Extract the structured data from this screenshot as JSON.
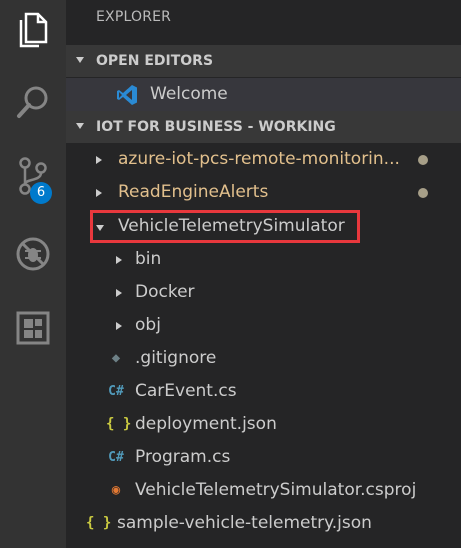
{
  "activity_bar": {
    "items": [
      {
        "icon": "files-icon"
      },
      {
        "icon": "search-icon"
      },
      {
        "icon": "source-control-icon",
        "badge": "6"
      },
      {
        "icon": "debug-icon"
      },
      {
        "icon": "extensions-icon"
      }
    ]
  },
  "sidebar": {
    "title": "EXPLORER",
    "open_editors": {
      "header": "OPEN EDITORS",
      "items": [
        {
          "label": "Welcome",
          "icon": "vscode-logo-icon"
        }
      ]
    },
    "workspace": {
      "header": "IOT FOR BUSINESS - WORKING",
      "items": [
        {
          "label": "azure-iot-pcs-remote-monitorin...",
          "type": "folder",
          "modified": true
        },
        {
          "label": "ReadEngineAlerts",
          "type": "folder",
          "modified": true
        },
        {
          "label": "VehicleTelemetrySimulator",
          "type": "folder",
          "expanded": true,
          "highlighted": true
        },
        {
          "label": "bin",
          "type": "folder"
        },
        {
          "label": "Docker",
          "type": "folder"
        },
        {
          "label": "obj",
          "type": "folder"
        },
        {
          "label": ".gitignore",
          "type": "file",
          "icon_glyph": "◆"
        },
        {
          "label": "CarEvent.cs",
          "type": "file",
          "icon_glyph": "C#"
        },
        {
          "label": "deployment.json",
          "type": "file",
          "icon_glyph": "{ }"
        },
        {
          "label": "Program.cs",
          "type": "file",
          "icon_glyph": "C#"
        },
        {
          "label": "VehicleTelemetrySimulator.csproj",
          "type": "file",
          "icon_glyph": "◉"
        },
        {
          "label": "sample-vehicle-telemetry.json",
          "type": "file",
          "icon_glyph": "{ }"
        }
      ]
    }
  },
  "colors": {
    "activity_bar": "#333333",
    "sidebar": "#252526",
    "badge": "#007acc",
    "highlight_border": "#e8383d",
    "modified_text": "#e2c08d"
  }
}
